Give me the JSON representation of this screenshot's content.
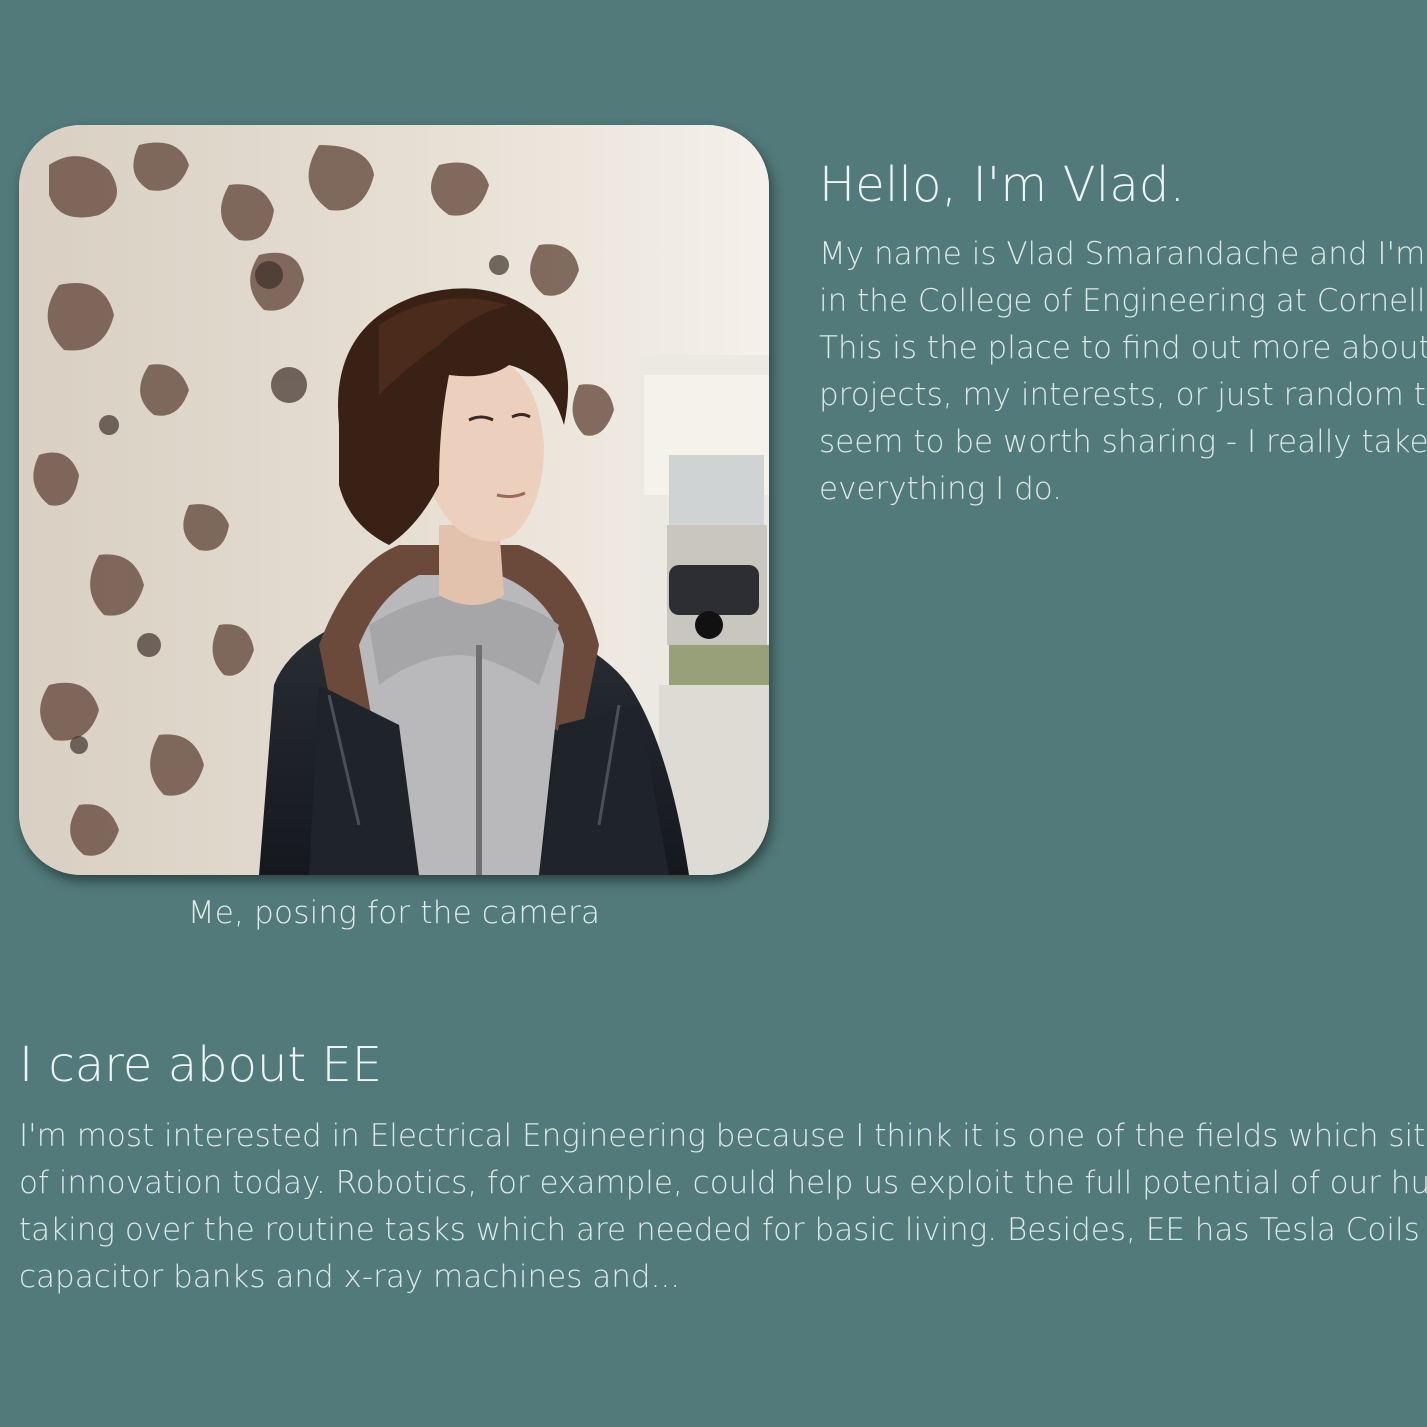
{
  "photo": {
    "alt": "Me, posing for the camera",
    "caption": "Me, posing for the camera"
  },
  "intro": {
    "heading": "Hello, I'm Vlad.",
    "lines": [
      "My name is Vlad Smarandache and I'm a f",
      "in the College of Engineering at Cornell Un",
      "This is the place to find out more about my",
      "projects, my interests, or just random thing",
      "seem to be worth sharing - I really take pri",
      "everything I do."
    ]
  },
  "ee": {
    "heading": "I care about EE",
    "lines": [
      "I'm most interested in Electrical Engineering because I think it is one of the fields which sit at the f",
      "of innovation today. Robotics, for example, could help us exploit the full potential of our human cre",
      "taking over the routine tasks which are needed for basic living. Besides, EE has Tesla Coils and da",
      "capacitor banks and x-ray machines and..."
    ]
  },
  "colors": {
    "background": "#527a7a",
    "text": "#dde8e8"
  }
}
